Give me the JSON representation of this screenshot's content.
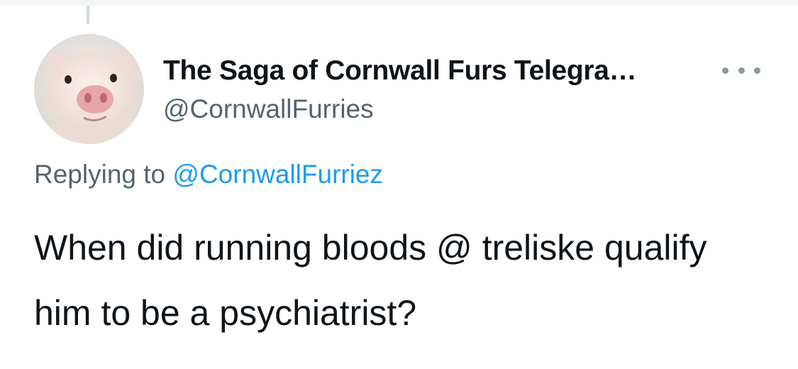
{
  "tweet": {
    "author": {
      "display_name": "The Saga of Cornwall Furs Telegra…",
      "handle": "@CornwallFurries",
      "avatar": "pig-avatar"
    },
    "more_icon": "more-horizontal-icon",
    "reply": {
      "prefix": "Replying to",
      "mention": "@CornwallFurriez"
    },
    "text": "When did running bloods @ treliske qualify him to be a psychiatrist?"
  },
  "colors": {
    "text_primary": "#0f1419",
    "text_secondary": "#536471",
    "link": "#1d9bf0",
    "thread_line": "#cfd9de",
    "background": "#ffffff"
  }
}
